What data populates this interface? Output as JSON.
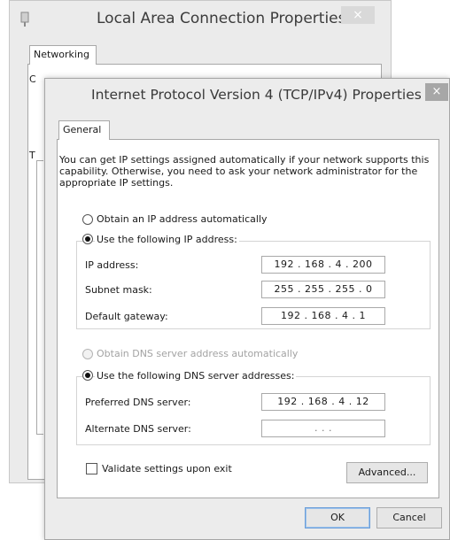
{
  "back_window": {
    "title": "Local Area Connection Properties",
    "close_glyph": "×",
    "tab_label": "Networking",
    "fragment_1": "C",
    "fragment_2": "T"
  },
  "dialog": {
    "title": "Internet Protocol Version 4 (TCP/IPv4) Properties",
    "close_glyph": "×",
    "tab_label": "General",
    "description": "You can get IP settings assigned automatically if your network supports this capability. Otherwise, you need to ask your network administrator for the appropriate IP settings.",
    "ip_auto_label": "Obtain an IP address automatically",
    "ip_manual_label": "Use the following IP address:",
    "ip_fields": [
      {
        "label": "IP address:",
        "value": "192 . 168 .  4  . 200"
      },
      {
        "label": "Subnet mask:",
        "value": "255 . 255 . 255 .  0"
      },
      {
        "label": "Default gateway:",
        "value": "192 . 168 .  4  .  1"
      }
    ],
    "dns_auto_label": "Obtain DNS server address automatically",
    "dns_manual_label": "Use the following DNS server addresses:",
    "dns_fields": [
      {
        "label": "Preferred DNS server:",
        "value": "192 . 168 .  4  . 12"
      },
      {
        "label": "Alternate DNS server:",
        "value": ".        .        ."
      }
    ],
    "validate_label": "Validate settings upon exit",
    "validate_checked": false,
    "advanced_label": "Advanced...",
    "ok_label": "OK",
    "cancel_label": "Cancel",
    "selected_ip_option": "manual",
    "selected_dns_option": "manual"
  }
}
